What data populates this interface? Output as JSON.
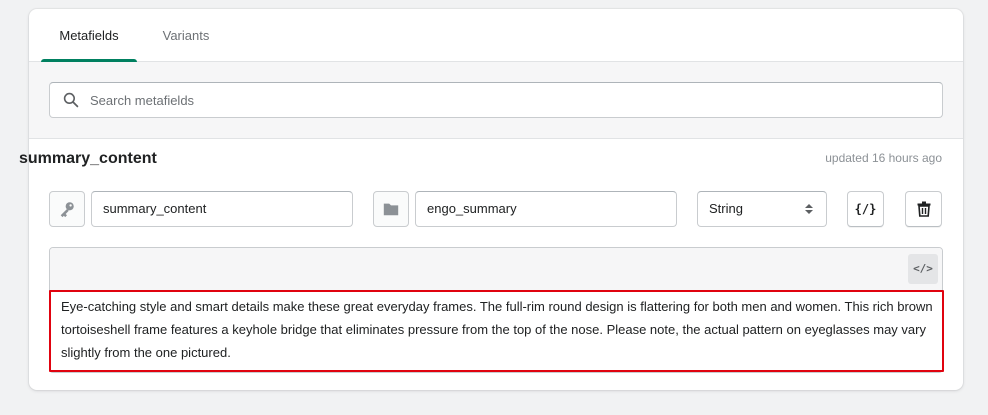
{
  "tabs": [
    {
      "label": "Metafields",
      "active": true
    },
    {
      "label": "Variants",
      "active": false
    }
  ],
  "search": {
    "placeholder": "Search metafields",
    "value": ""
  },
  "metafield": {
    "title": "summary_content",
    "updated": "updated 16 hours ago",
    "key": "summary_content",
    "namespace": "engo_summary",
    "type": "String",
    "type_options": [
      "String"
    ],
    "json_button_label": "{/}",
    "code_view_label": "</>",
    "value": "Eye-catching style and smart details make these great everyday frames. The full-rim round design is flattering for both men and women. This rich brown tortoiseshell frame features a keyhole bridge that eliminates pressure from the top of the nose. Please note, the actual pattern on eyeglasses may vary slightly from the one pictured."
  },
  "colors": {
    "accent": "#008060",
    "highlight": "#e0030f",
    "text": "#202223",
    "muted": "#6d7175"
  },
  "icons": {
    "search": "search-icon",
    "key": "key-icon",
    "folder": "folder-icon",
    "select": "select-arrows-icon",
    "delete": "trash-icon",
    "code": "code-icon"
  }
}
